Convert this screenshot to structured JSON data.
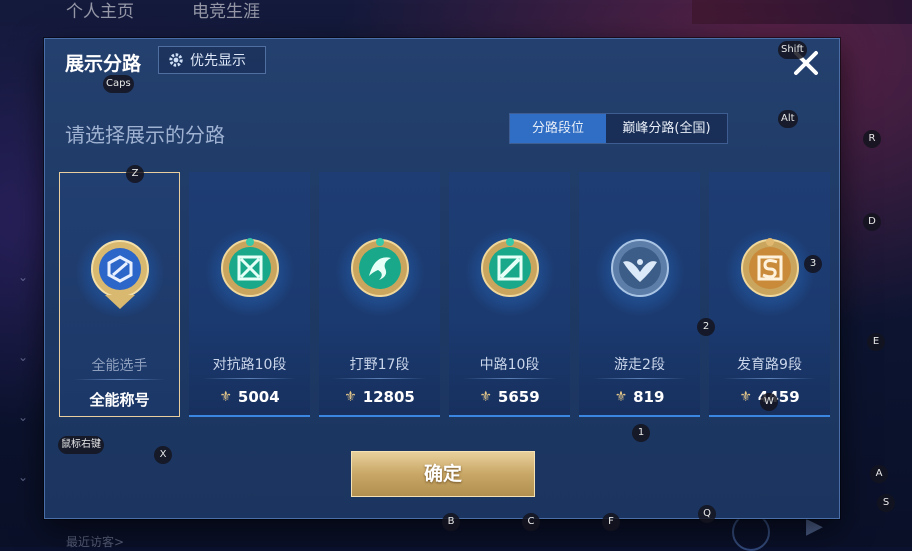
{
  "background": {
    "top_tabs": [
      "个人主页",
      "电竞生涯"
    ],
    "recent_visitors": "最近访客>"
  },
  "dialog": {
    "title": "展示分路",
    "priority_button": "优先显示",
    "prompt": "请选择展示的分路",
    "segments": [
      "分路段位",
      "巅峰分路(全国)"
    ],
    "cards": [
      {
        "rank": "全能选手",
        "value": "全能称号",
        "emblem": "all-round-emblem-icon",
        "color": "#3a7ad8",
        "selected": true
      },
      {
        "rank": "对抗路10段",
        "value": "5004",
        "emblem": "clash-lane-emblem-icon",
        "color": "#1fbf9a",
        "selected": false
      },
      {
        "rank": "打野17段",
        "value": "12805",
        "emblem": "jungle-emblem-icon",
        "color": "#1fbf9a",
        "selected": false
      },
      {
        "rank": "中路10段",
        "value": "5659",
        "emblem": "mid-lane-emblem-icon",
        "color": "#1fbf9a",
        "selected": false
      },
      {
        "rank": "游走2段",
        "value": "819",
        "emblem": "roam-emblem-icon",
        "color": "#8fb4dc",
        "selected": false
      },
      {
        "rank": "发育路9段",
        "value": "4459",
        "emblem": "farm-lane-emblem-icon",
        "color": "#d9a35a",
        "selected": false
      }
    ],
    "confirm": "确定"
  },
  "key_hints": [
    "Caps",
    "Shift",
    "Alt",
    "R",
    "D",
    "3",
    "2",
    "E",
    "Z",
    "鼠标右键",
    "X",
    "1",
    "W",
    "A",
    "S",
    "B",
    "C",
    "F",
    "Q"
  ],
  "colors": {
    "accent": "#2f6ec4",
    "gold": "#e5c98a",
    "panel": "#1f3a66"
  }
}
